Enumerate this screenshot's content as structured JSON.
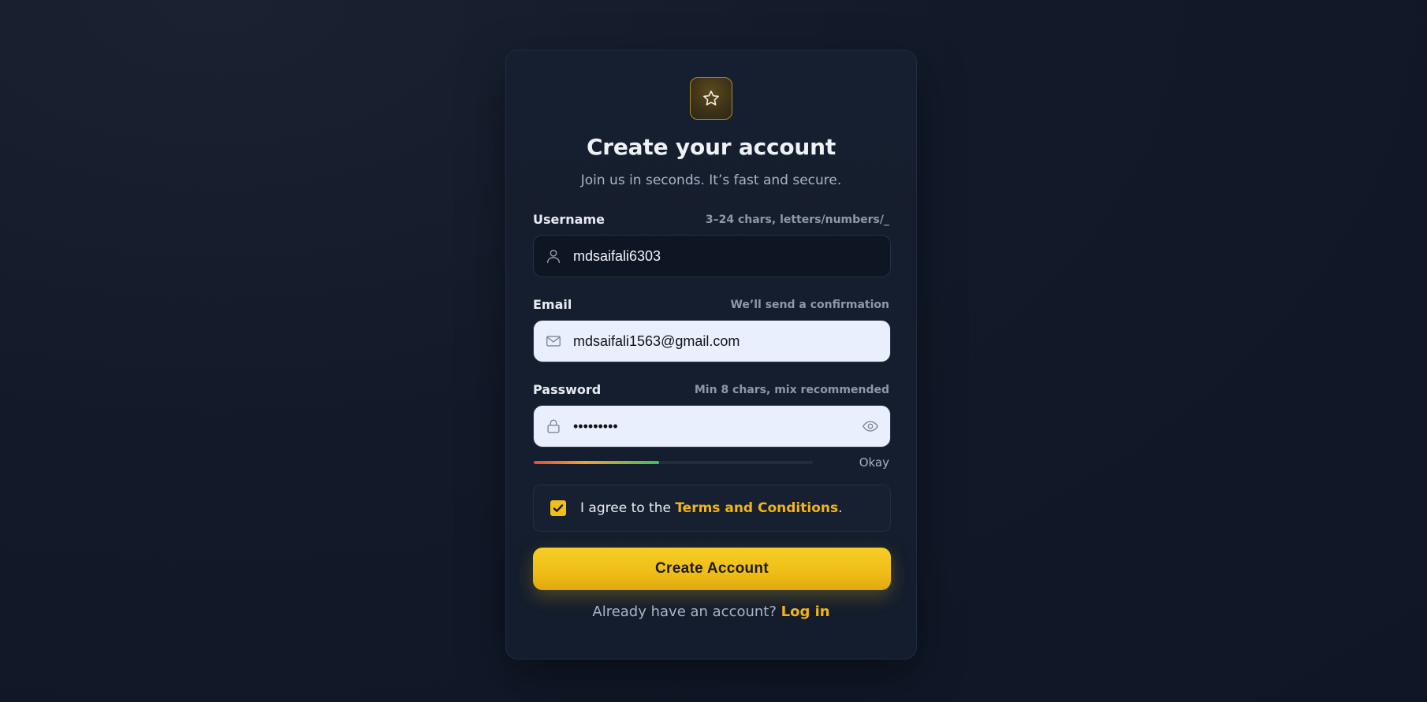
{
  "brand": {
    "logo_icon": "star-icon",
    "accent_color": "#f2be19"
  },
  "header": {
    "title": "Create your account",
    "subtitle": "Join us in seconds. It’s fast and secure."
  },
  "fields": {
    "username": {
      "label": "Username",
      "hint": "3–24 chars, letters/numbers/_",
      "value": "mdsaifali6303",
      "icon": "user-icon"
    },
    "email": {
      "label": "Email",
      "hint": "We’ll send a confirmation",
      "value": "mdsaifali1563@gmail.com",
      "icon": "mail-icon"
    },
    "password": {
      "label": "Password",
      "hint": "Min 8 chars, mix recommended",
      "value": "•••••••••",
      "icon": "lock-icon",
      "toggle_icon": "eye-icon"
    }
  },
  "strength": {
    "label": "Okay",
    "level": 0.45
  },
  "terms": {
    "checked": true,
    "prefix": "I agree to the ",
    "link": "Terms and Conditions",
    "suffix": "."
  },
  "actions": {
    "submit_label": "Create Account"
  },
  "footer": {
    "prompt": "Already have an account? ",
    "link": "Log in"
  }
}
